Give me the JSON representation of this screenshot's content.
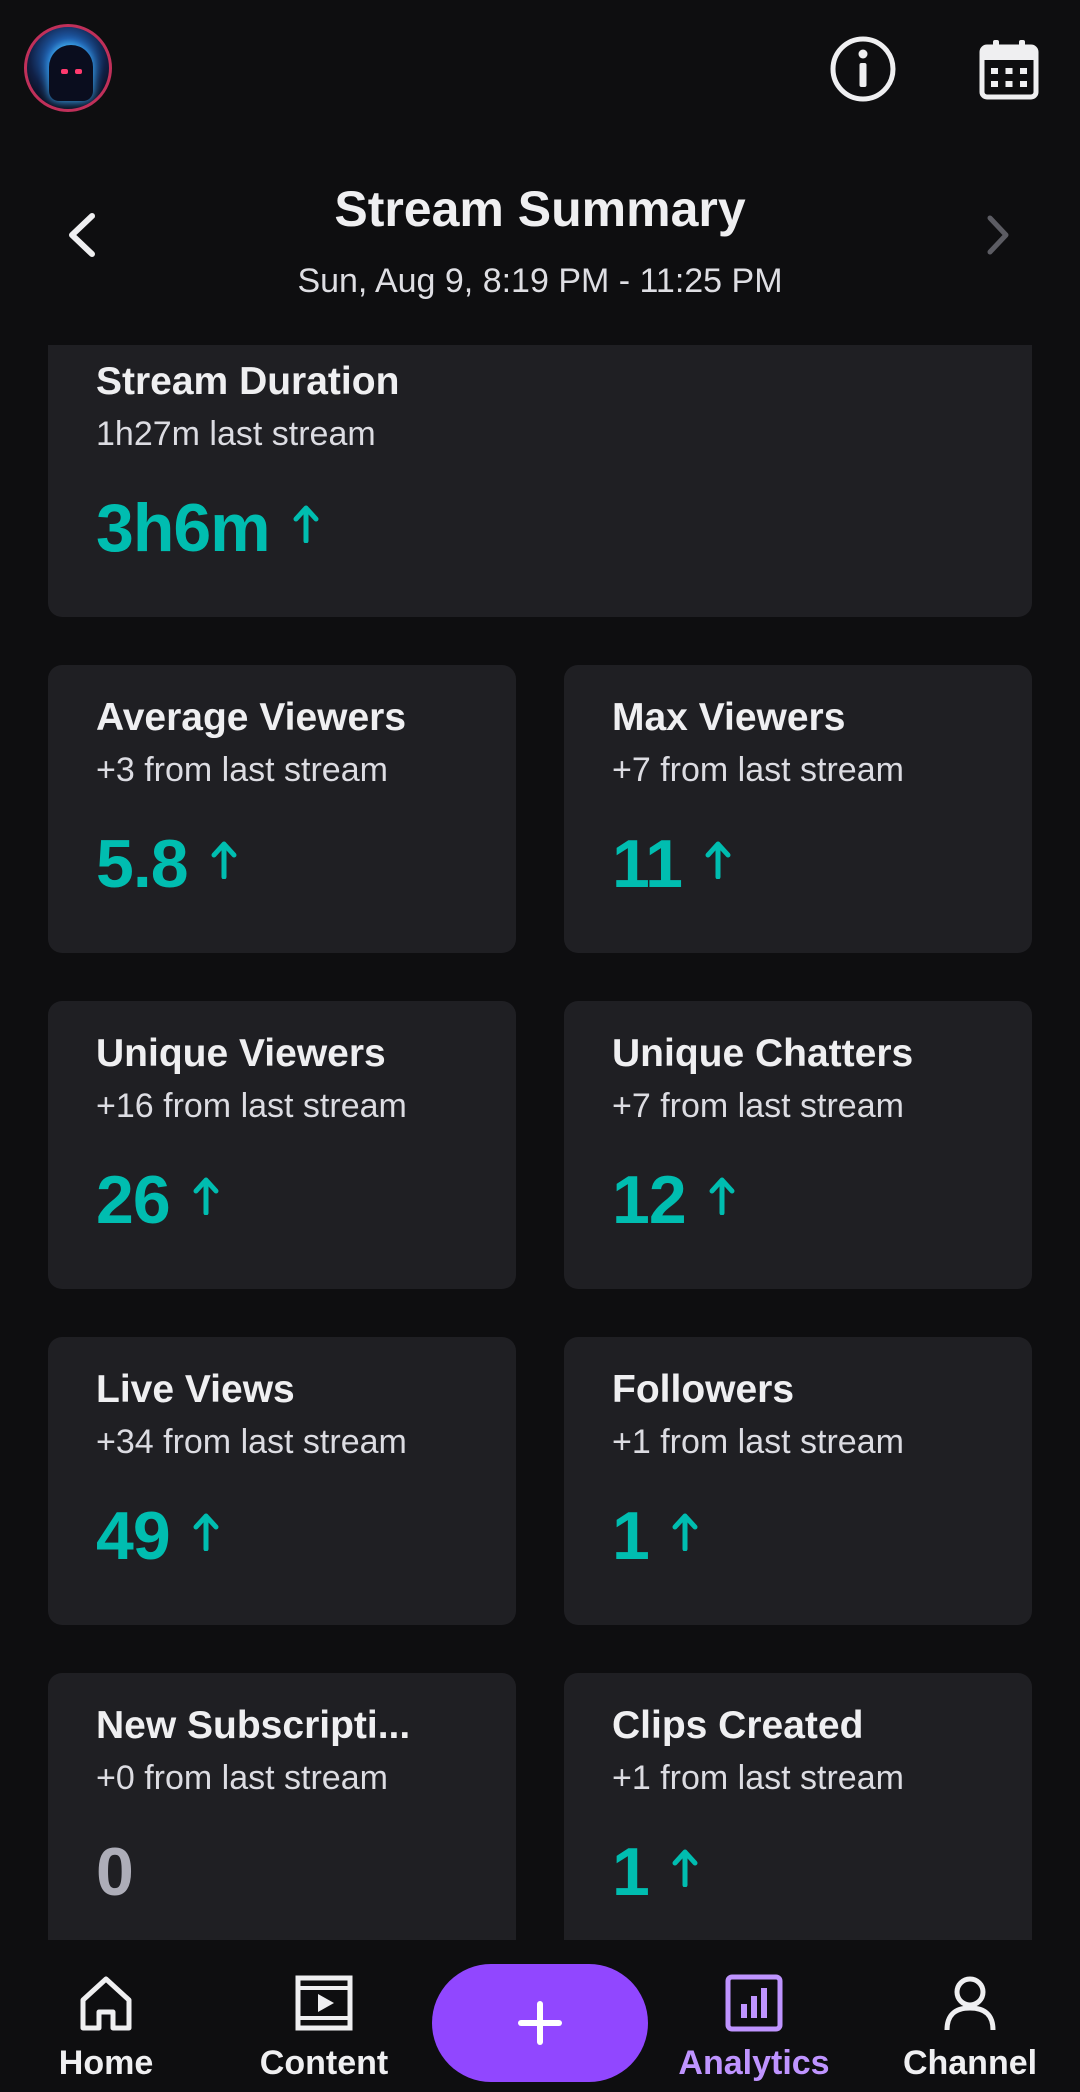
{
  "header": {
    "title": "Stream Summary",
    "date_range": "Sun, Aug 9, 8:19 PM - 11:25 PM"
  },
  "icons": {
    "avatar": "avatar",
    "info": "info-icon",
    "calendar": "calendar-icon",
    "prev": "chevron-left-icon",
    "next": "chevron-right-icon",
    "trend_up": "arrow-up-icon"
  },
  "colors": {
    "background": "#0e0e10",
    "card": "#1f1f23",
    "positive": "#00bdb0",
    "neutral": "#adadb8",
    "accent": "#9147ff",
    "active_nav": "#bf94ff"
  },
  "stats": {
    "duration": {
      "title": "Stream Duration",
      "subtitle": "1h27m last stream",
      "value": "3h6m",
      "trend": "up"
    },
    "avg_viewers": {
      "title": "Average Viewers",
      "subtitle": "+3 from last stream",
      "value": "5.8",
      "trend": "up"
    },
    "max_viewers": {
      "title": "Max Viewers",
      "subtitle": "+7 from last stream",
      "value": "11",
      "trend": "up"
    },
    "unique_viewers": {
      "title": "Unique Viewers",
      "subtitle": "+16 from last stream",
      "value": "26",
      "trend": "up"
    },
    "unique_chatters": {
      "title": "Unique Chatters",
      "subtitle": "+7 from last stream",
      "value": "12",
      "trend": "up"
    },
    "live_views": {
      "title": "Live Views",
      "subtitle": "+34 from last stream",
      "value": "49",
      "trend": "up"
    },
    "followers": {
      "title": "Followers",
      "subtitle": "+1 from last stream",
      "value": "1",
      "trend": "up"
    },
    "new_subs": {
      "title": "New Subscripti...",
      "subtitle": "+0 from last stream",
      "value": "0",
      "trend": "none"
    },
    "clips": {
      "title": "Clips Created",
      "subtitle": "+1 from last stream",
      "value": "1",
      "trend": "up"
    }
  },
  "bottom_nav": {
    "home": "Home",
    "content": "Content",
    "create": "+",
    "analytics": "Analytics",
    "channel": "Channel",
    "active": "Analytics"
  }
}
